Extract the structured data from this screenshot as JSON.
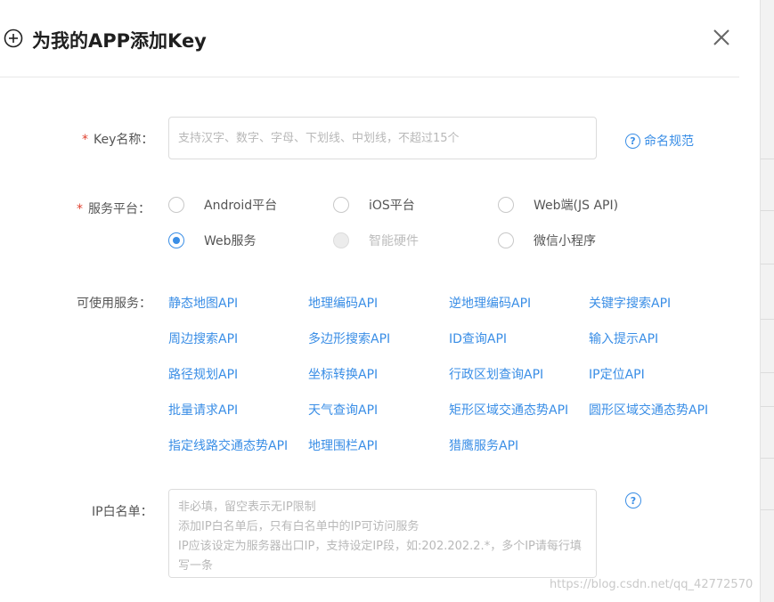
{
  "dialog": {
    "title": "为我的APP添加Key"
  },
  "form": {
    "required_mark": "*",
    "key_name": {
      "label": "Key名称：",
      "placeholder": "支持汉字、数字、字母、下划线、中划线，不超过15个",
      "help_text": "命名规范"
    },
    "platform": {
      "label": "服务平台：",
      "options": [
        {
          "label": "Android平台",
          "checked": false,
          "disabled": false
        },
        {
          "label": "iOS平台",
          "checked": false,
          "disabled": false
        },
        {
          "label": "Web端(JS API)",
          "checked": false,
          "disabled": false
        },
        {
          "label": "Web服务",
          "checked": true,
          "disabled": false
        },
        {
          "label": "智能硬件",
          "checked": false,
          "disabled": true
        },
        {
          "label": "微信小程序",
          "checked": false,
          "disabled": false
        }
      ]
    },
    "services": {
      "label": "可使用服务：",
      "items": [
        "静态地图API",
        "地理编码API",
        "逆地理编码API",
        "关键字搜索API",
        "周边搜索API",
        "多边形搜索API",
        "ID查询API",
        "输入提示API",
        "路径规划API",
        "坐标转换API",
        "行政区划查询API",
        "IP定位API",
        "批量请求API",
        "天气查询API",
        "矩形区域交通态势API",
        "圆形区域交通态势API",
        "指定线路交通态势API",
        "地理围栏API",
        "猎鹰服务API"
      ]
    },
    "ip_whitelist": {
      "label": "IP白名单：",
      "placeholder": "非必填，留空表示无IP限制\n添加IP白名单后，只有白名单中的IP可访问服务\nIP应该设定为服务器出口IP，支持设定IP段，如:202.202.2.*，多个IP请每行填写一条"
    }
  },
  "watermark": "https://blog.csdn.net/qq_42772570",
  "icons": {
    "plus": "plus-circle-icon",
    "close": "close-icon",
    "help": "question-circle-icon"
  },
  "colors": {
    "accent": "#3a8ee6",
    "required": "#e0412f"
  }
}
